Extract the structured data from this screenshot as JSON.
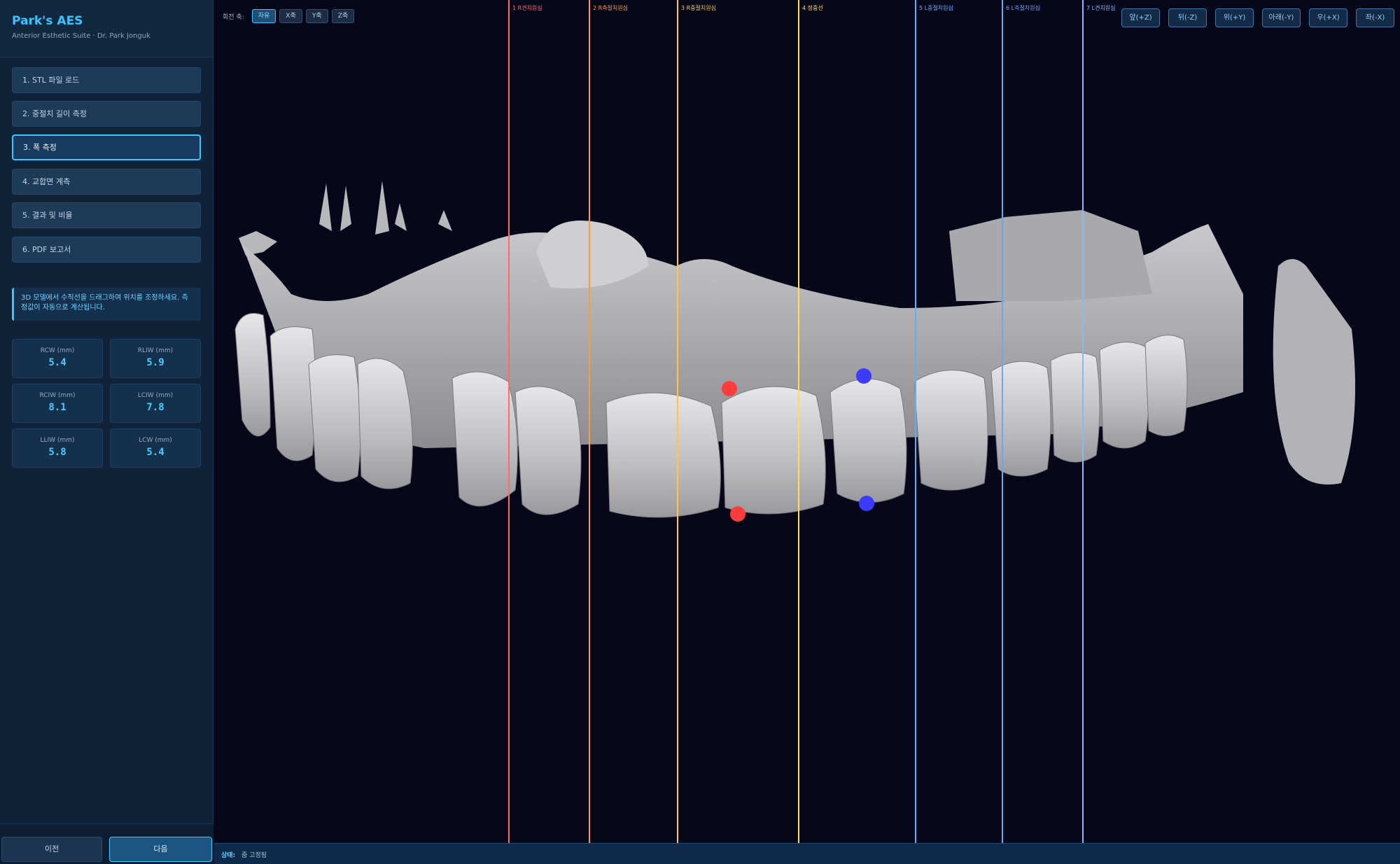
{
  "app": {
    "title": "Park's AES",
    "subtitle": "Anterior Esthetic Suite · Dr. Park Jonguk"
  },
  "steps": [
    {
      "label": "1. STL 파일 로드",
      "active": false
    },
    {
      "label": "2. 중절치 길이 측정",
      "active": false
    },
    {
      "label": "3. 폭 측정",
      "active": true
    },
    {
      "label": "4. 교합면 계측",
      "active": false
    },
    {
      "label": "5. 결과 및 비율",
      "active": false
    },
    {
      "label": "6. PDF 보고서",
      "active": false
    }
  ],
  "hint": "3D 모델에서 수직선을 드래그하여 위치를 조정하세요. 측정값이 자동으로 계산됩니다.",
  "measurements": [
    {
      "label": "RCW (mm)",
      "value": "5.4"
    },
    {
      "label": "RLIW (mm)",
      "value": "5.9"
    },
    {
      "label": "RCIW (mm)",
      "value": "8.1"
    },
    {
      "label": "LCIW (mm)",
      "value": "7.8"
    },
    {
      "label": "LLIW (mm)",
      "value": "5.8"
    },
    {
      "label": "LCW (mm)",
      "value": "5.4"
    }
  ],
  "footer": {
    "prev": "이전",
    "next": "다음"
  },
  "rotation": {
    "label": "회전 축:",
    "options": [
      "자유",
      "X축",
      "Y축",
      "Z축"
    ],
    "selected": "자유"
  },
  "views": [
    "앞(+Z)",
    "뒤(-Z)",
    "위(+Y)",
    "아래(-Y)",
    "우(+X)",
    "좌(-X)"
  ],
  "lines": [
    {
      "label": "1 R견치원심",
      "color": "#ff6b6b"
    },
    {
      "label": "2 R측절치원심",
      "color": "#ff9a3c"
    },
    {
      "label": "3 R중절치원심",
      "color": "#ffc83c"
    },
    {
      "label": "4 정중선",
      "color": "#ffe24a"
    },
    {
      "label": "5 L중절치원심",
      "color": "#5ab0ff"
    },
    {
      "label": "6 L측절치원심",
      "color": "#6aa8f0"
    },
    {
      "label": "7 L견치원심",
      "color": "#8ab8f5"
    }
  ],
  "points": {
    "right_color": "#ff3b3b",
    "left_color": "#3b3bff"
  },
  "status": {
    "label": "상태:",
    "value": "줌 고정됨"
  }
}
